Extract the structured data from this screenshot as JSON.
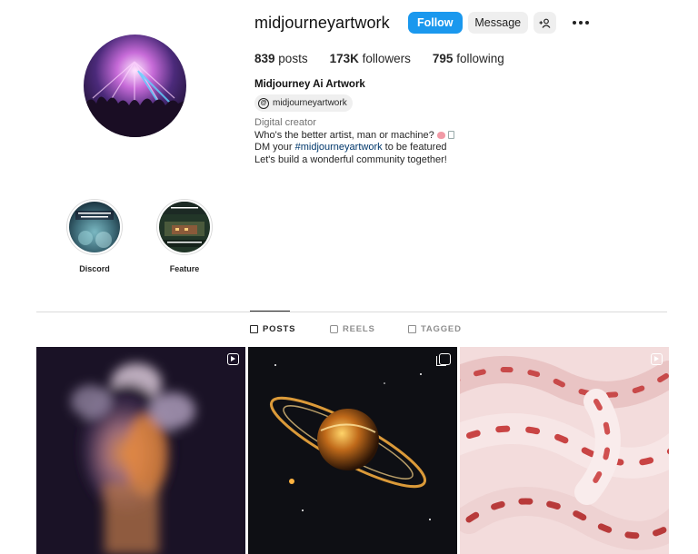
{
  "profile": {
    "username": "midjourneyartwork",
    "follow_label": "Follow",
    "message_label": "Message",
    "add_user_icon": "+⌂",
    "full_name": "Midjourney Ai Artwork",
    "threads_handle": "midjourneyartwork",
    "threads_icon": "@"
  },
  "stats": {
    "posts_count": "839",
    "posts_label": "posts",
    "followers_count": "173K",
    "followers_label": "followers",
    "following_count": "795",
    "following_label": "following"
  },
  "bio": {
    "category": "Digital creator",
    "line1": "Who's the better artist, man or machine?",
    "line2_pre": "DM your ",
    "line2_hashtag": "#midjourneyartwork",
    "line2_post": " to be featured",
    "line3": "Let's build a wonderful community together!"
  },
  "highlights": [
    {
      "label": "Discord",
      "cover_text": "Click below to join our Community Discord"
    },
    {
      "label": "Feature",
      "cover_text_top": "be featured",
      "cover_text_bottom": "The images not the post"
    }
  ],
  "tabs": [
    {
      "label": "POSTS",
      "active": true,
      "icon": "grid-icon"
    },
    {
      "label": "REELS",
      "active": false,
      "icon": "reels-icon"
    },
    {
      "label": "TAGGED",
      "active": false,
      "icon": "tagged-icon"
    }
  ],
  "grid": {
    "tiles": [
      {
        "subject": "blurred ghostly figure with orange smoke",
        "badge": "reel-icon"
      },
      {
        "subject": "glowing planet with fiery rings in space",
        "badge": "multiple-images-icon"
      },
      {
        "subject": "red and white candy cane swirls",
        "badge": "reel-icon"
      }
    ]
  },
  "colors": {
    "follow_button": "#1a98ee",
    "secondary_button": "#efefef",
    "hashtag": "#00376b",
    "muted_text": "#737373",
    "divider": "#dbdbdb"
  }
}
